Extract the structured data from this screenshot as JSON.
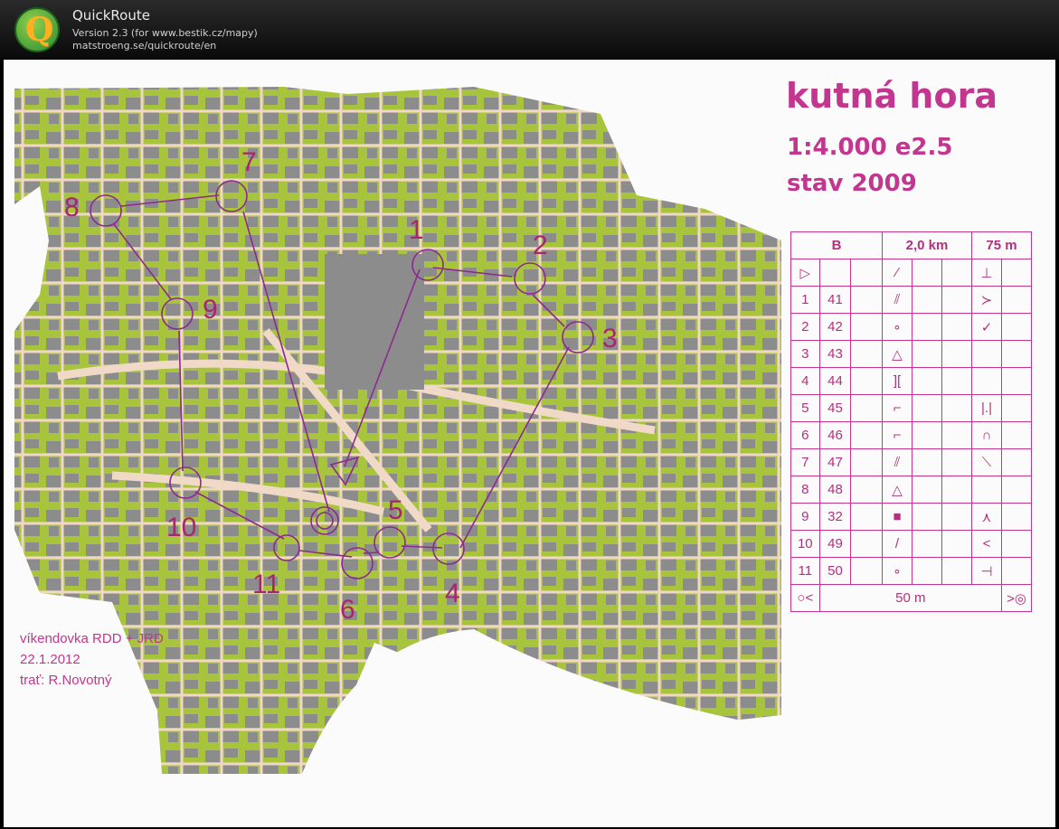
{
  "app": {
    "name": "QuickRoute",
    "version": "Version 2.3  (for www.bestik.cz/mapy)",
    "url": "matstroeng.se/quickroute/en"
  },
  "map": {
    "title": "kutná hora",
    "scale": "1:4.000  e2.5",
    "edition": "stav 2009",
    "footer": {
      "event": "víkendovka RDD + JRD",
      "date": "22.1.2012",
      "course_setter": "trať: R.Novotný"
    },
    "control_labels": [
      "1",
      "2",
      "3",
      "4",
      "5",
      "6",
      "7",
      "8",
      "9",
      "10",
      "11"
    ]
  },
  "descriptions": {
    "course": "B",
    "length": "2,0 km",
    "climb": "75 m",
    "controls": [
      {
        "num": "1",
        "code": "41"
      },
      {
        "num": "2",
        "code": "42"
      },
      {
        "num": "3",
        "code": "43"
      },
      {
        "num": "4",
        "code": "44"
      },
      {
        "num": "5",
        "code": "45"
      },
      {
        "num": "6",
        "code": "46"
      },
      {
        "num": "7",
        "code": "47"
      },
      {
        "num": "8",
        "code": "48"
      },
      {
        "num": "9",
        "code": "32"
      },
      {
        "num": "10",
        "code": "49"
      },
      {
        "num": "11",
        "code": "50"
      }
    ],
    "finish": "50 m"
  },
  "colors": {
    "course": "#8b2a8f",
    "text": "#c2368f",
    "green": "#a7c23a",
    "building": "#8a8a8a"
  }
}
